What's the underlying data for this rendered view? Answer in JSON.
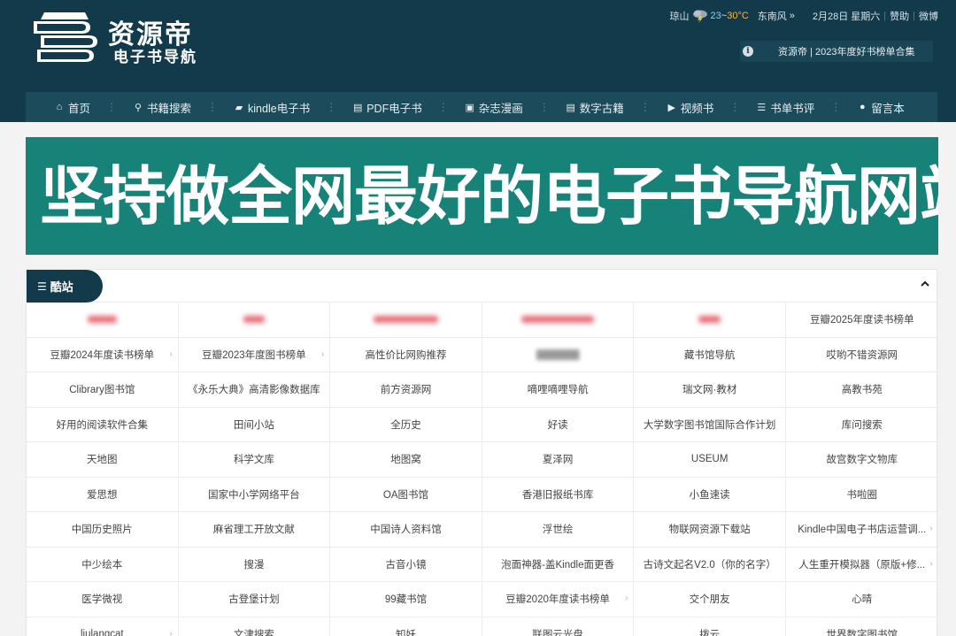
{
  "header": {
    "logo_title": "资源帝",
    "logo_subtitle": "电子书导航",
    "topbar": {
      "city": "琼山",
      "weather_icon": "thunderstorm-icon",
      "temp_low": "23",
      "temp_sep": "~",
      "temp_high": "30°C",
      "wind": "东南风",
      "more": "»",
      "date": "2月28日",
      "weekday": "星期六",
      "donate": "赞助",
      "weibo": "微博"
    },
    "notice": "资源帝 | 2023年度好书榜单合集"
  },
  "nav": {
    "items": [
      {
        "label": "首页",
        "icon": "home-icon",
        "glyph": "⌂"
      },
      {
        "label": "书籍搜索",
        "icon": "search-icon",
        "glyph": "⚲"
      },
      {
        "label": "kindle电子书",
        "icon": "book-icon",
        "glyph": "▰"
      },
      {
        "label": "PDF电子书",
        "icon": "file-pdf-icon",
        "glyph": "▤"
      },
      {
        "label": "杂志漫画",
        "icon": "image-icon",
        "glyph": "▣"
      },
      {
        "label": "数字古籍",
        "icon": "file-text-icon",
        "glyph": "▤"
      },
      {
        "label": "视频书",
        "icon": "video-icon",
        "glyph": "▶"
      },
      {
        "label": "书单书评",
        "icon": "list-icon",
        "glyph": "☰"
      },
      {
        "label": "留言本",
        "icon": "comments-icon",
        "glyph": "●"
      }
    ],
    "separator": "⋮"
  },
  "banner": {
    "text": "坚持做全网最好的电子书导航网站"
  },
  "section": {
    "title": "酷站",
    "title_icon": "bars-icon",
    "collapse_icon": "chevron-up-icon"
  },
  "grid": {
    "rows": [
      [
        {
          "label": "████",
          "blur": "red"
        },
        {
          "label": "███",
          "blur": "red"
        },
        {
          "label": "█████████",
          "blur": "red"
        },
        {
          "label": "██████████",
          "blur": "red"
        },
        {
          "label": "███",
          "blur": "red"
        },
        {
          "label": "豆瓣2025年度读书榜单"
        }
      ],
      [
        {
          "label": "豆瓣2024年度读书榜单",
          "arrow": true
        },
        {
          "label": "豆瓣2023年度图书榜单",
          "arrow": true
        },
        {
          "label": "高性价比网购推荐"
        },
        {
          "label": "██████",
          "blur": "grey"
        },
        {
          "label": "藏书馆导航"
        },
        {
          "label": "哎哟不错资源网"
        }
      ],
      [
        {
          "label": "Clibrary图书馆"
        },
        {
          "label": "《永乐大典》高清影像数据库"
        },
        {
          "label": "前方资源网"
        },
        {
          "label": "嘀哩嘀哩导航"
        },
        {
          "label": "瑞文网·教材"
        },
        {
          "label": "高教书苑"
        }
      ],
      [
        {
          "label": "好用的阅读软件合集"
        },
        {
          "label": "田间小站"
        },
        {
          "label": "全历史"
        },
        {
          "label": "好读"
        },
        {
          "label": "大学数字图书馆国际合作计划"
        },
        {
          "label": "库问搜索"
        }
      ],
      [
        {
          "label": "天地图"
        },
        {
          "label": "科学文库"
        },
        {
          "label": "地图窝"
        },
        {
          "label": "夏泽网"
        },
        {
          "label": "USEUM"
        },
        {
          "label": "故宫数字文物库"
        }
      ],
      [
        {
          "label": "爱思想"
        },
        {
          "label": "国家中小学网络平台"
        },
        {
          "label": "OA图书馆"
        },
        {
          "label": "香港旧报纸书库"
        },
        {
          "label": "小鱼速读"
        },
        {
          "label": "书啦圈"
        }
      ],
      [
        {
          "label": "中国历史照片"
        },
        {
          "label": "麻省理工开放文献"
        },
        {
          "label": "中国诗人资料馆"
        },
        {
          "label": "浮世绘"
        },
        {
          "label": "物联网资源下载站"
        },
        {
          "label": "Kindle中国电子书店运营调...",
          "arrow": true
        }
      ],
      [
        {
          "label": "中少绘本"
        },
        {
          "label": "搜漫"
        },
        {
          "label": "古音小镜"
        },
        {
          "label": "泡面神器-盖Kindle面更香"
        },
        {
          "label": "古诗文起名V2.0（你的名字）"
        },
        {
          "label": "人生重开模拟器（原版+修...",
          "arrow": true
        }
      ],
      [
        {
          "label": "医学微视"
        },
        {
          "label": "古登堡计划"
        },
        {
          "label": "99藏书馆"
        },
        {
          "label": "豆瓣2020年度读书榜单",
          "arrow": true
        },
        {
          "label": "交个朋友"
        },
        {
          "label": "心晴"
        }
      ],
      [
        {
          "label": "liulangcat",
          "arrow": true
        },
        {
          "label": "文津搜索"
        },
        {
          "label": "知妖"
        },
        {
          "label": "联图云光盘"
        },
        {
          "label": "拨云"
        },
        {
          "label": "世界数字图书馆"
        }
      ]
    ]
  },
  "colors": {
    "header_bg": "#123a4a",
    "nav_bg": "#1c4c5c",
    "banner_bg": "#168278",
    "temp_low": "#8ad0ff",
    "temp_high": "#ffb24a"
  }
}
